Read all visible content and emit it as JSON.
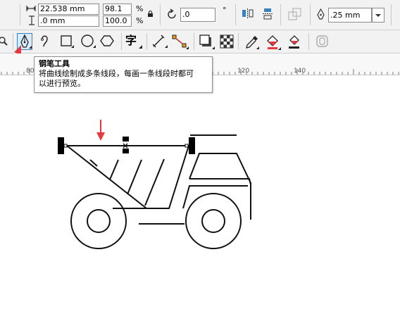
{
  "property_bar": {
    "width_value": "22.538 mm",
    "height_value": ".0 mm",
    "scale_x": "98.1",
    "scale_y": "100.0",
    "percent_symbol": "%",
    "rotation_value": ".0",
    "outline_width": ".25 mm"
  },
  "toolbar": {
    "tools": [
      "zoom-tool",
      "pen-tool",
      "bspline-tool",
      "rectangle-tool",
      "ellipse-tool",
      "polygon-tool",
      "text-tool",
      "dimension-tool",
      "connector-tool",
      "drop-shadow-tool",
      "transparency-tool",
      "eyedropper-tool",
      "interactive-fill-tool",
      "smart-fill-tool",
      "outline-tool"
    ],
    "selected": "pen-tool",
    "text_tool_glyph": "字"
  },
  "ruler": {
    "ticks": [
      "80",
      "120",
      "140"
    ]
  },
  "tooltip": {
    "title": "钢笔工具",
    "description_line1": "将曲线绘制成多条线段，每画一条线段时都可",
    "description_line2": "以进行预览。"
  },
  "colors": {
    "accent": "#e8383d",
    "selection_border": "#3c7fc1",
    "panel": "#f2f2f2"
  }
}
